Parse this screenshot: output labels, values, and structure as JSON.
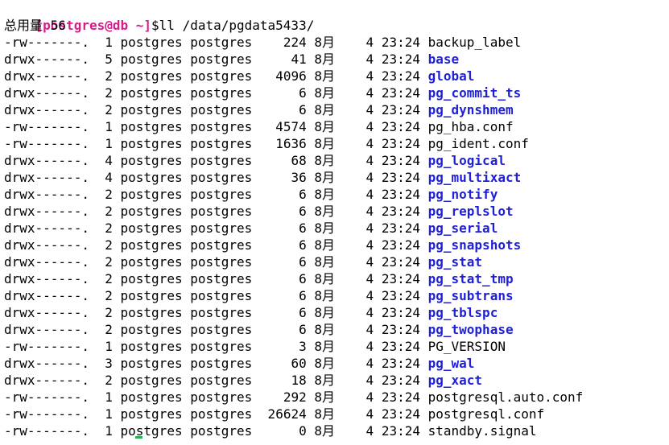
{
  "prompt": {
    "user_host": "[postgres@db ~]",
    "symbol": "$",
    "command": "ll /data/pgdata5433/"
  },
  "summary": "总用量 56",
  "listing": [
    {
      "perms": "-rw-------.",
      "links": "1",
      "owner": "postgres",
      "group": "postgres",
      "size": "224",
      "month": "8月",
      "day": "4",
      "time": "23:24",
      "name": "backup_label",
      "is_dir": false
    },
    {
      "perms": "drwx------.",
      "links": "5",
      "owner": "postgres",
      "group": "postgres",
      "size": "41",
      "month": "8月",
      "day": "4",
      "time": "23:24",
      "name": "base",
      "is_dir": true
    },
    {
      "perms": "drwx------.",
      "links": "2",
      "owner": "postgres",
      "group": "postgres",
      "size": "4096",
      "month": "8月",
      "day": "4",
      "time": "23:24",
      "name": "global",
      "is_dir": true
    },
    {
      "perms": "drwx------.",
      "links": "2",
      "owner": "postgres",
      "group": "postgres",
      "size": "6",
      "month": "8月",
      "day": "4",
      "time": "23:24",
      "name": "pg_commit_ts",
      "is_dir": true
    },
    {
      "perms": "drwx------.",
      "links": "2",
      "owner": "postgres",
      "group": "postgres",
      "size": "6",
      "month": "8月",
      "day": "4",
      "time": "23:24",
      "name": "pg_dynshmem",
      "is_dir": true
    },
    {
      "perms": "-rw-------.",
      "links": "1",
      "owner": "postgres",
      "group": "postgres",
      "size": "4574",
      "month": "8月",
      "day": "4",
      "time": "23:24",
      "name": "pg_hba.conf",
      "is_dir": false
    },
    {
      "perms": "-rw-------.",
      "links": "1",
      "owner": "postgres",
      "group": "postgres",
      "size": "1636",
      "month": "8月",
      "day": "4",
      "time": "23:24",
      "name": "pg_ident.conf",
      "is_dir": false
    },
    {
      "perms": "drwx------.",
      "links": "4",
      "owner": "postgres",
      "group": "postgres",
      "size": "68",
      "month": "8月",
      "day": "4",
      "time": "23:24",
      "name": "pg_logical",
      "is_dir": true
    },
    {
      "perms": "drwx------.",
      "links": "4",
      "owner": "postgres",
      "group": "postgres",
      "size": "36",
      "month": "8月",
      "day": "4",
      "time": "23:24",
      "name": "pg_multixact",
      "is_dir": true
    },
    {
      "perms": "drwx------.",
      "links": "2",
      "owner": "postgres",
      "group": "postgres",
      "size": "6",
      "month": "8月",
      "day": "4",
      "time": "23:24",
      "name": "pg_notify",
      "is_dir": true
    },
    {
      "perms": "drwx------.",
      "links": "2",
      "owner": "postgres",
      "group": "postgres",
      "size": "6",
      "month": "8月",
      "day": "4",
      "time": "23:24",
      "name": "pg_replslot",
      "is_dir": true
    },
    {
      "perms": "drwx------.",
      "links": "2",
      "owner": "postgres",
      "group": "postgres",
      "size": "6",
      "month": "8月",
      "day": "4",
      "time": "23:24",
      "name": "pg_serial",
      "is_dir": true
    },
    {
      "perms": "drwx------.",
      "links": "2",
      "owner": "postgres",
      "group": "postgres",
      "size": "6",
      "month": "8月",
      "day": "4",
      "time": "23:24",
      "name": "pg_snapshots",
      "is_dir": true
    },
    {
      "perms": "drwx------.",
      "links": "2",
      "owner": "postgres",
      "group": "postgres",
      "size": "6",
      "month": "8月",
      "day": "4",
      "time": "23:24",
      "name": "pg_stat",
      "is_dir": true
    },
    {
      "perms": "drwx------.",
      "links": "2",
      "owner": "postgres",
      "group": "postgres",
      "size": "6",
      "month": "8月",
      "day": "4",
      "time": "23:24",
      "name": "pg_stat_tmp",
      "is_dir": true
    },
    {
      "perms": "drwx------.",
      "links": "2",
      "owner": "postgres",
      "group": "postgres",
      "size": "6",
      "month": "8月",
      "day": "4",
      "time": "23:24",
      "name": "pg_subtrans",
      "is_dir": true
    },
    {
      "perms": "drwx------.",
      "links": "2",
      "owner": "postgres",
      "group": "postgres",
      "size": "6",
      "month": "8月",
      "day": "4",
      "time": "23:24",
      "name": "pg_tblspc",
      "is_dir": true
    },
    {
      "perms": "drwx------.",
      "links": "2",
      "owner": "postgres",
      "group": "postgres",
      "size": "6",
      "month": "8月",
      "day": "4",
      "time": "23:24",
      "name": "pg_twophase",
      "is_dir": true
    },
    {
      "perms": "-rw-------.",
      "links": "1",
      "owner": "postgres",
      "group": "postgres",
      "size": "3",
      "month": "8月",
      "day": "4",
      "time": "23:24",
      "name": "PG_VERSION",
      "is_dir": false
    },
    {
      "perms": "drwx------.",
      "links": "3",
      "owner": "postgres",
      "group": "postgres",
      "size": "60",
      "month": "8月",
      "day": "4",
      "time": "23:24",
      "name": "pg_wal",
      "is_dir": true
    },
    {
      "perms": "drwx------.",
      "links": "2",
      "owner": "postgres",
      "group": "postgres",
      "size": "18",
      "month": "8月",
      "day": "4",
      "time": "23:24",
      "name": "pg_xact",
      "is_dir": true
    },
    {
      "perms": "-rw-------.",
      "links": "1",
      "owner": "postgres",
      "group": "postgres",
      "size": "292",
      "month": "8月",
      "day": "4",
      "time": "23:24",
      "name": "postgresql.auto.conf",
      "is_dir": false
    },
    {
      "perms": "-rw-------.",
      "links": "1",
      "owner": "postgres",
      "group": "postgres",
      "size": "26624",
      "month": "8月",
      "day": "4",
      "time": "23:24",
      "name": "postgresql.conf",
      "is_dir": false
    },
    {
      "perms": "-rw-------.",
      "links": "1",
      "owner": "postgres",
      "group": "postgres",
      "size": "0",
      "month": "8月",
      "day": "4",
      "time": "23:24",
      "name": "standby.signal",
      "is_dir": false
    }
  ],
  "colors": {
    "prompt": "#d81b8a",
    "directory": "#1f1fd6",
    "text": "#000000",
    "background": "#ffffff",
    "cursor": "#22b14c"
  }
}
